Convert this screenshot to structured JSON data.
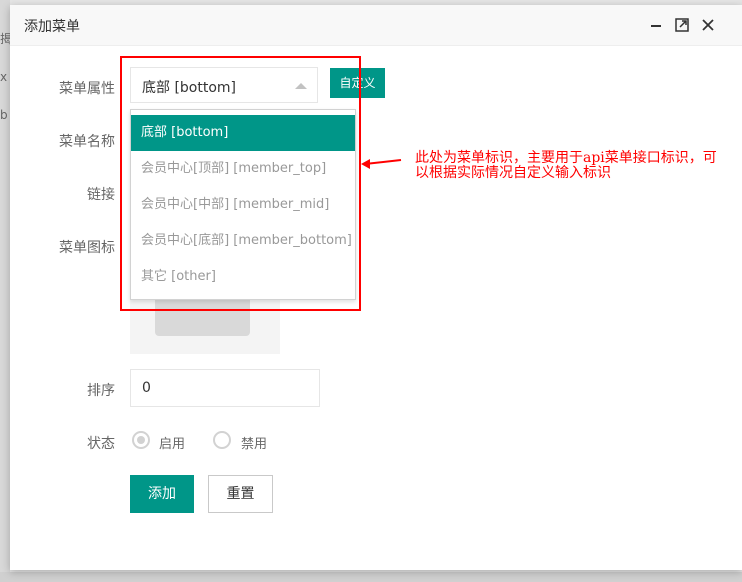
{
  "background": {
    "fragments": [
      "揭",
      "x",
      "b"
    ]
  },
  "dialog": {
    "title": "添加菜单",
    "controls": [
      "minimize-icon",
      "maximize-icon",
      "close-icon"
    ]
  },
  "form": {
    "labels": {
      "attribute": "菜单属性",
      "name": "菜单名称",
      "link": "链接",
      "icon": "菜单图标",
      "sort": "排序",
      "status": "状态"
    },
    "attribute_select": {
      "selected": "底部 [bottom]",
      "options": [
        "底部 [bottom]",
        "会员中心[顶部] [member_top]",
        "会员中心[中部] [member_mid]",
        "会员中心[底部] [member_bottom]",
        "其它 [other]"
      ]
    },
    "custom_button": "自定义",
    "sort_value": "0",
    "status_options": {
      "enabled": "启用",
      "disabled": "禁用"
    },
    "add_button": "添加",
    "reset_button": "重置"
  },
  "annotation": {
    "line1": "此处为菜单标识，主要用于api菜单接口标识，可",
    "line2": "以根据实际情况自定义输入标识"
  },
  "colors": {
    "primary": "#009688",
    "annotation": "#ff0000"
  }
}
